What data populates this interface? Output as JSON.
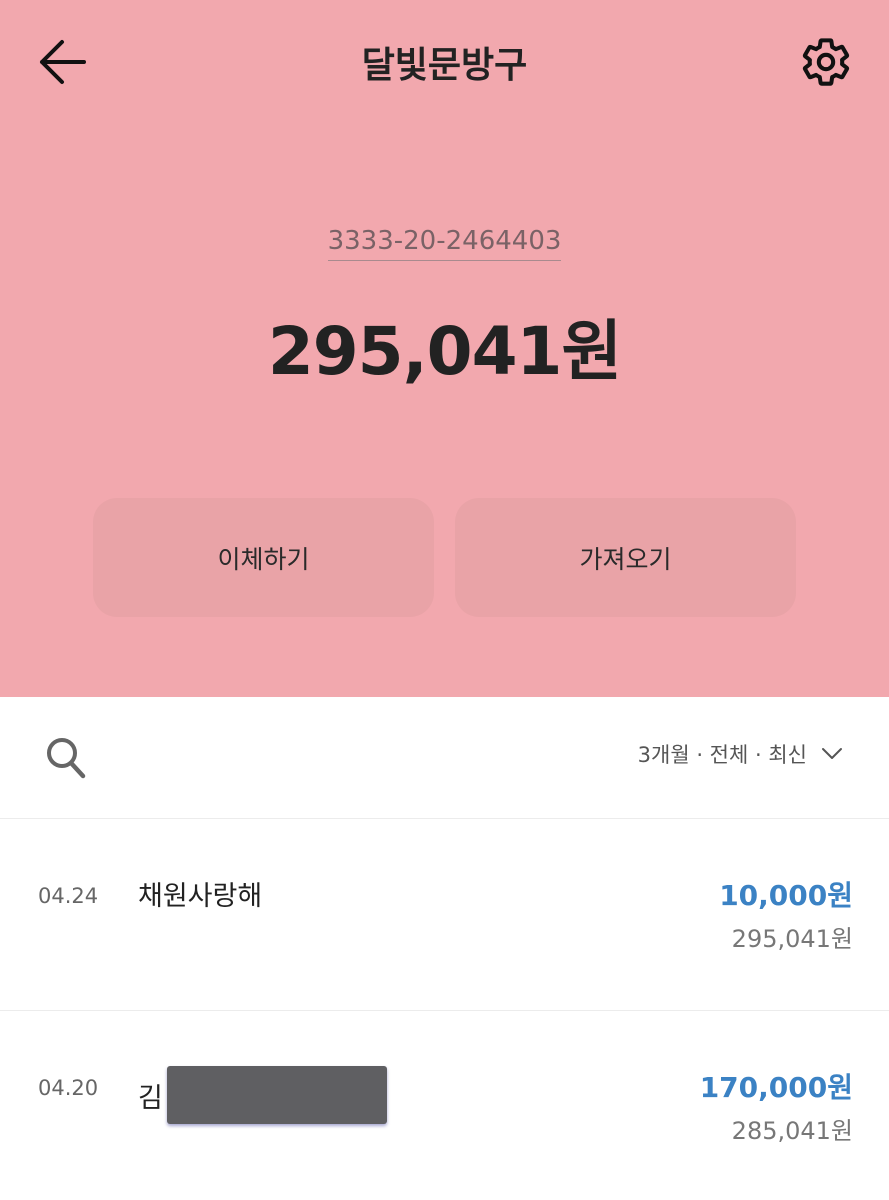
{
  "header": {
    "title": "달빛문방구",
    "back_icon": "arrow-left-icon",
    "settings_icon": "gear-icon"
  },
  "account": {
    "number": "3333-20-2464403",
    "balance": "295,041원"
  },
  "actions": {
    "transfer_label": "이체하기",
    "fetch_label": "가져오기"
  },
  "filter": {
    "search_icon": "search-icon",
    "label": "3개월 · 전체 · 최신",
    "dropdown_icon": "chevron-down-icon"
  },
  "transactions": [
    {
      "date": "04.24",
      "name": "채원사랑해",
      "amount": "10,000원",
      "balance_after": "295,041원"
    },
    {
      "date": "04.20",
      "name": "김",
      "amount": "170,000원",
      "balance_after": "285,041원"
    }
  ],
  "colors": {
    "hero_bg": "#f2a8ae",
    "button_bg": "#e9a3a7",
    "deposit_amount": "#3b82c4"
  }
}
